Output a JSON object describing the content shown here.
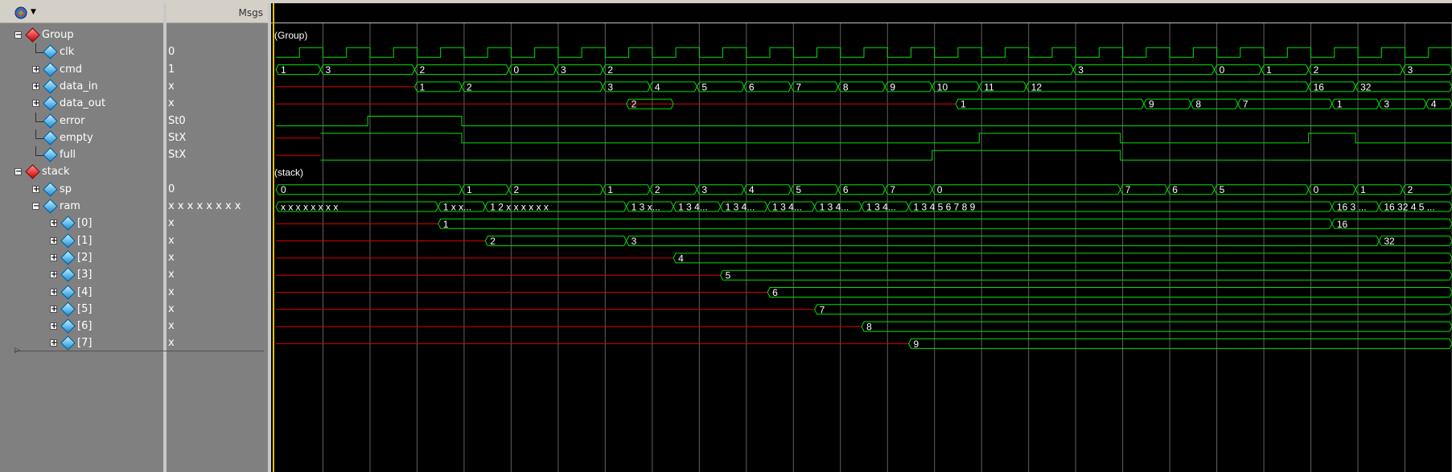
{
  "header": {
    "msgs_label": "Msgs"
  },
  "signals": [
    {
      "name": "Group",
      "value": "",
      "kind": "group",
      "level": 0,
      "expand": "-"
    },
    {
      "name": "clk",
      "value": "0",
      "kind": "leaf",
      "level": 1,
      "expand": ""
    },
    {
      "name": "cmd",
      "value": "1",
      "kind": "leaf",
      "level": 1,
      "expand": "+"
    },
    {
      "name": "data_in",
      "value": "x",
      "kind": "leaf",
      "level": 1,
      "expand": "+"
    },
    {
      "name": "data_out",
      "value": "x",
      "kind": "leaf",
      "level": 1,
      "expand": "+"
    },
    {
      "name": "error",
      "value": "St0",
      "kind": "leaf",
      "level": 1,
      "expand": ""
    },
    {
      "name": "empty",
      "value": "StX",
      "kind": "leaf",
      "level": 1,
      "expand": ""
    },
    {
      "name": "full",
      "value": "StX",
      "kind": "leaf",
      "level": 1,
      "expand": ""
    },
    {
      "name": "stack",
      "value": "",
      "kind": "group",
      "level": 0,
      "expand": "-"
    },
    {
      "name": "sp",
      "value": "0",
      "kind": "leaf",
      "level": 1,
      "expand": "+"
    },
    {
      "name": "ram",
      "value": "x x x x x x x x",
      "kind": "leaf",
      "level": 1,
      "expand": "-"
    },
    {
      "name": "[0]",
      "value": "x",
      "kind": "leaf",
      "level": 2,
      "expand": "+"
    },
    {
      "name": "[1]",
      "value": "x",
      "kind": "leaf",
      "level": 2,
      "expand": "+"
    },
    {
      "name": "[2]",
      "value": "x",
      "kind": "leaf",
      "level": 2,
      "expand": "+"
    },
    {
      "name": "[3]",
      "value": "x",
      "kind": "leaf",
      "level": 2,
      "expand": "+"
    },
    {
      "name": "[4]",
      "value": "x",
      "kind": "leaf",
      "level": 2,
      "expand": "+"
    },
    {
      "name": "[5]",
      "value": "x",
      "kind": "leaf",
      "level": 2,
      "expand": "+"
    },
    {
      "name": "[6]",
      "value": "x",
      "kind": "leaf",
      "level": 2,
      "expand": "+"
    },
    {
      "name": "[7]",
      "value": "x",
      "kind": "leaf",
      "level": 2,
      "expand": "+"
    }
  ],
  "waves": {
    "time_end": 25,
    "grid_every": 1,
    "clk": {
      "period": 1,
      "high_first": false
    },
    "rows": [
      {
        "row": 0,
        "type": "label",
        "text": "(Group)"
      },
      {
        "row": 1,
        "type": "clock"
      },
      {
        "row": 2,
        "type": "bus",
        "segs": [
          [
            0,
            0.95,
            "1"
          ],
          [
            0.95,
            2.95,
            "3"
          ],
          [
            2.95,
            4.95,
            "2"
          ],
          [
            4.95,
            5.95,
            "0"
          ],
          [
            5.95,
            6.95,
            "3"
          ],
          [
            6.95,
            16.95,
            "2"
          ],
          [
            16.95,
            19.95,
            "3"
          ],
          [
            19.95,
            20.95,
            "0"
          ],
          [
            20.95,
            21.95,
            "1"
          ],
          [
            21.95,
            23.95,
            "2"
          ],
          [
            23.95,
            25,
            "3"
          ]
        ]
      },
      {
        "row": 3,
        "type": "bus",
        "undef_until": 2.95,
        "segs": [
          [
            2.95,
            3.95,
            "1"
          ],
          [
            3.95,
            6.95,
            "2"
          ],
          [
            6.95,
            7.95,
            "3"
          ],
          [
            7.95,
            8.95,
            "4"
          ],
          [
            8.95,
            9.95,
            "5"
          ],
          [
            9.95,
            10.95,
            "6"
          ],
          [
            10.95,
            11.95,
            "7"
          ],
          [
            11.95,
            12.95,
            "8"
          ],
          [
            12.95,
            13.95,
            "9"
          ],
          [
            13.95,
            14.95,
            "10"
          ],
          [
            14.95,
            15.95,
            "11"
          ],
          [
            15.95,
            21.95,
            "12"
          ],
          [
            21.95,
            22.95,
            "16"
          ],
          [
            22.95,
            25,
            "32"
          ]
        ]
      },
      {
        "row": 4,
        "type": "bus",
        "undef_until": 14.45,
        "pulse": [
          7.45,
          8.45,
          "2"
        ],
        "segs": [
          [
            14.45,
            18.45,
            "1"
          ],
          [
            18.45,
            19.45,
            "9"
          ],
          [
            19.45,
            20.45,
            "8"
          ],
          [
            20.45,
            22.45,
            "7"
          ],
          [
            22.45,
            23.45,
            "1"
          ],
          [
            23.45,
            24.45,
            "3"
          ],
          [
            24.45,
            25,
            "4"
          ]
        ]
      },
      {
        "row": 5,
        "type": "bit",
        "undef_until": 0,
        "edges": [
          [
            0,
            0
          ],
          [
            1.95,
            1
          ],
          [
            3.95,
            0
          ]
        ]
      },
      {
        "row": 6,
        "type": "bit",
        "undef_until": 0.95,
        "edges": [
          [
            0.95,
            1
          ],
          [
            3.95,
            0
          ],
          [
            14.95,
            1
          ],
          [
            17.95,
            0
          ],
          [
            21.95,
            1
          ],
          [
            22.95,
            0
          ]
        ]
      },
      {
        "row": 7,
        "type": "bit",
        "undef_until": 0.95,
        "edges": [
          [
            0.95,
            0
          ],
          [
            13.95,
            1
          ],
          [
            17.95,
            0
          ]
        ]
      },
      {
        "row": 8,
        "type": "label",
        "text": "(stack)"
      },
      {
        "row": 9,
        "type": "bus",
        "segs": [
          [
            0,
            3.95,
            "0"
          ],
          [
            3.95,
            4.95,
            "1"
          ],
          [
            4.95,
            6.95,
            "2"
          ],
          [
            6.95,
            7.95,
            "1"
          ],
          [
            7.95,
            8.95,
            "2"
          ],
          [
            8.95,
            9.95,
            "3"
          ],
          [
            9.95,
            10.95,
            "4"
          ],
          [
            10.95,
            11.95,
            "5"
          ],
          [
            11.95,
            12.95,
            "6"
          ],
          [
            12.95,
            13.95,
            "7"
          ],
          [
            13.95,
            17.95,
            "0"
          ],
          [
            17.95,
            18.95,
            "7"
          ],
          [
            18.95,
            19.95,
            "6"
          ],
          [
            19.95,
            21.95,
            "5"
          ],
          [
            21.95,
            22.95,
            "0"
          ],
          [
            22.95,
            23.95,
            "1"
          ],
          [
            23.95,
            25,
            "2"
          ]
        ]
      },
      {
        "row": 10,
        "type": "bus",
        "segs": [
          [
            0,
            3.45,
            "x x x x x x x x"
          ],
          [
            3.45,
            4.45,
            "1 x x..."
          ],
          [
            4.45,
            7.45,
            "1 2 x x x x x x"
          ],
          [
            7.45,
            8.45,
            "1 3 x..."
          ],
          [
            8.45,
            9.45,
            "1 3 4..."
          ],
          [
            9.45,
            10.45,
            "1 3 4..."
          ],
          [
            10.45,
            11.45,
            "1 3 4..."
          ],
          [
            11.45,
            12.45,
            "1 3 4..."
          ],
          [
            12.45,
            13.45,
            "1 3 4..."
          ],
          [
            13.45,
            22.45,
            "1 3 4 5 6 7 8 9"
          ],
          [
            22.45,
            23.45,
            "16 3 ..."
          ],
          [
            23.45,
            25,
            "16 32 4 5 ..."
          ]
        ]
      },
      {
        "row": 11,
        "type": "bus",
        "undef_until": 3.45,
        "segs": [
          [
            3.45,
            22.45,
            "1"
          ],
          [
            22.45,
            25,
            "16"
          ]
        ]
      },
      {
        "row": 12,
        "type": "bus",
        "undef_until": 4.45,
        "segs": [
          [
            4.45,
            7.45,
            "2"
          ],
          [
            7.45,
            23.45,
            "3"
          ],
          [
            23.45,
            25,
            "32"
          ]
        ]
      },
      {
        "row": 13,
        "type": "bus",
        "undef_until": 8.45,
        "segs": [
          [
            8.45,
            25,
            "4"
          ]
        ]
      },
      {
        "row": 14,
        "type": "bus",
        "undef_until": 9.45,
        "segs": [
          [
            9.45,
            25,
            "5"
          ]
        ]
      },
      {
        "row": 15,
        "type": "bus",
        "undef_until": 10.45,
        "segs": [
          [
            10.45,
            25,
            "6"
          ]
        ]
      },
      {
        "row": 16,
        "type": "bus",
        "undef_until": 11.45,
        "segs": [
          [
            11.45,
            25,
            "7"
          ]
        ]
      },
      {
        "row": 17,
        "type": "bus",
        "undef_until": 12.45,
        "segs": [
          [
            12.45,
            25,
            "8"
          ]
        ]
      },
      {
        "row": 18,
        "type": "bus",
        "undef_until": 13.45,
        "segs": [
          [
            13.45,
            25,
            "9"
          ]
        ]
      }
    ]
  },
  "colors": {
    "wave": "#00e000",
    "undef": "#e00000",
    "grid": "#606060",
    "text": "#ffffff",
    "cursor": "#e8c000"
  }
}
